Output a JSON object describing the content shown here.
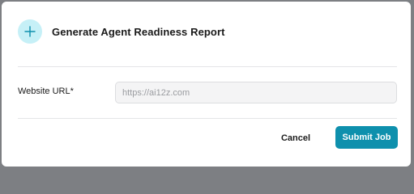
{
  "dialog": {
    "title": "Generate Agent Readiness Report",
    "icon": "plus-icon",
    "accent_color": "#0e90ad",
    "icon_background": "#c6f0f7"
  },
  "form": {
    "website_url": {
      "label": "Website URL*",
      "value": "",
      "placeholder": "https://ai12z.com"
    }
  },
  "actions": {
    "cancel_label": "Cancel",
    "submit_label": "Submit Job"
  }
}
